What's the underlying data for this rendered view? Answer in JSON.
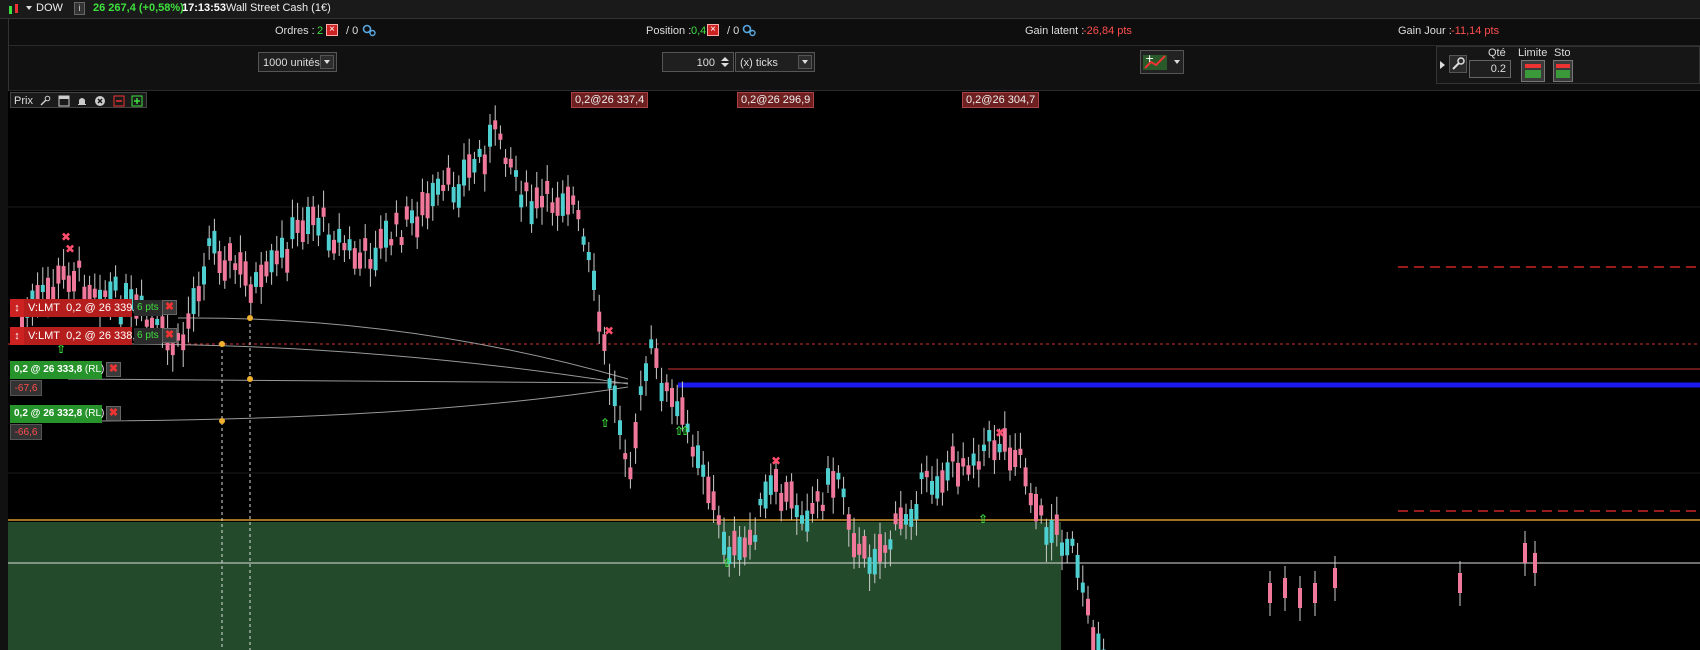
{
  "title_bar": {
    "symbol": "DOW",
    "info": "i",
    "price_change": "26 267,4 (+0,58%)",
    "time": "17:13:53",
    "instrument": "Wall Street Cash (1€)"
  },
  "summary": {
    "orders_label": "Ordres :",
    "orders_value": "2",
    "orders_zero": "/ 0",
    "position_label": "Position :",
    "position_value": "0,4",
    "position_zero": "/ 0",
    "gain_latent_label": "Gain latent :",
    "gain_latent_value": "-26,84 pts",
    "gain_jour_label": "Gain Jour :",
    "gain_jour_value": "-11,14 pts"
  },
  "toolbar": {
    "units_select": "1000 unités",
    "ticks_value": "100",
    "ticks_select": "(x) ticks",
    "qty_label": "Qté",
    "qty_value": "0.2",
    "limit_label": "Limite",
    "stop_label": "Sto"
  },
  "chart": {
    "panel_label": "Prix",
    "top_tags": [
      "0,2@26 337,4",
      "0,2@26 296,9",
      "0,2@26 304,7"
    ],
    "orders": [
      {
        "label": "V:LMT",
        "value": "0,2 @ 26 339,8",
        "pts": "6 pts"
      },
      {
        "label": "V:LMT",
        "value": "0,2 @ 26 338,8",
        "pts": "6 pts"
      }
    ],
    "positions": [
      {
        "value": "0,2 @ 26 333,8",
        "tag": "(RL)",
        "pnl": "-67,6"
      },
      {
        "value": "0,2 @ 26 332,8",
        "tag": "(RL)",
        "pnl": "-66,6"
      }
    ]
  },
  "colors": {
    "bull": "#4fd0d0",
    "bear": "#f0789a",
    "profit_zone": "#234a2a",
    "negative": "#ff4d4d",
    "positive": "#3ee03e"
  }
}
